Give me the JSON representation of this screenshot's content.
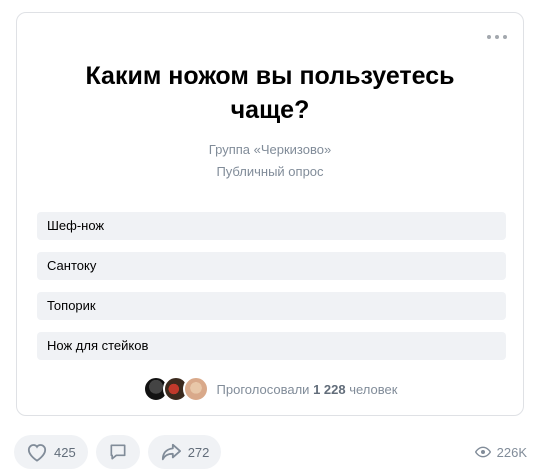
{
  "poll": {
    "question": "Каким ножом вы пользуетесь чаще?",
    "group": "Группа «Черкизово»",
    "type": "Публичный опрос",
    "options": [
      "Шеф-нож",
      "Сантоку",
      "Топорик",
      "Нож для стейков"
    ],
    "voters_prefix": "Проголосовали",
    "voters_count": "1 228",
    "voters_suffix": "человек"
  },
  "actions": {
    "likes": "425",
    "shares": "272",
    "views": "226K"
  },
  "icons": {
    "more": "more-dots-icon",
    "like": "heart-icon",
    "comment": "comment-icon",
    "share": "share-arrow-icon",
    "views": "eye-icon"
  }
}
